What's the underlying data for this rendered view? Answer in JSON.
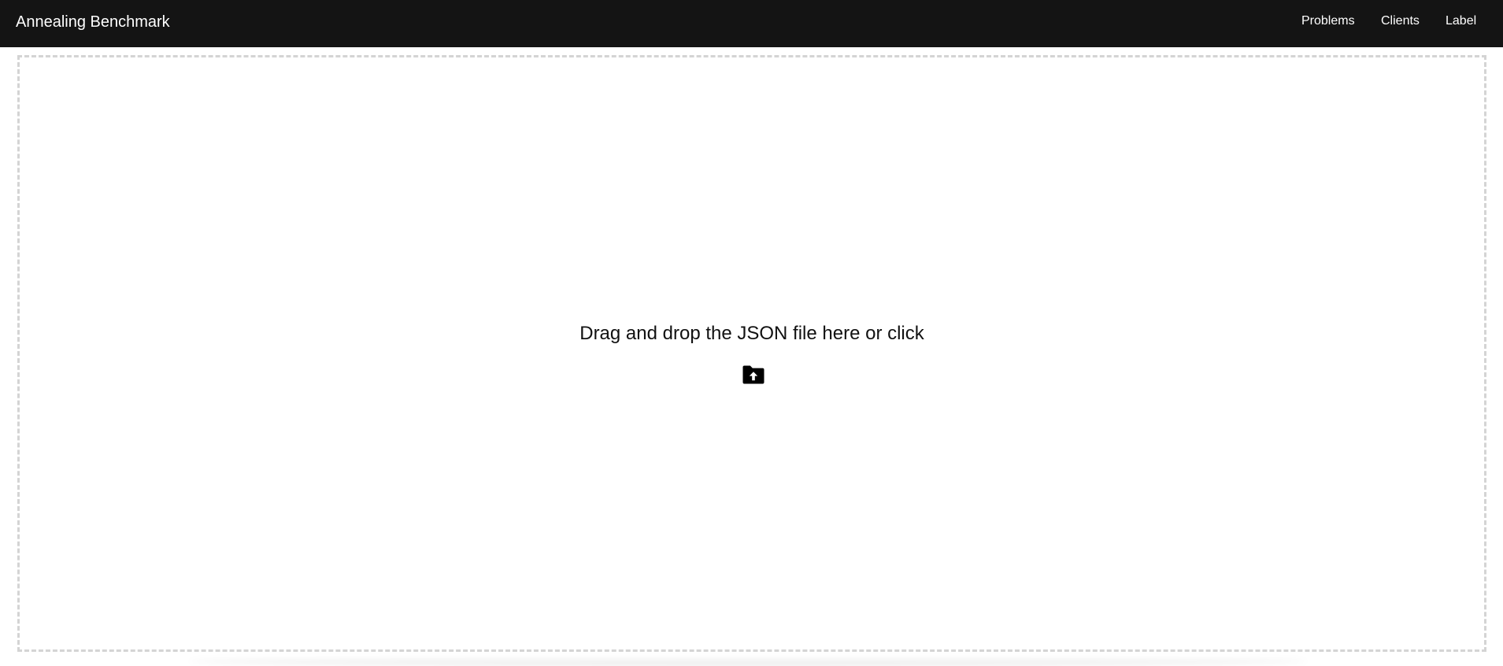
{
  "navbar": {
    "brand": "Annealing Benchmark",
    "links": [
      {
        "label": "Problems"
      },
      {
        "label": "Clients"
      },
      {
        "label": "Label"
      }
    ],
    "background_color": "#141414",
    "text_color": "#ffffff"
  },
  "dropzone": {
    "prompt": "Drag and drop the JSON file here or click",
    "icon": "folder-upload-icon",
    "border_color": "#d4d4d4"
  }
}
